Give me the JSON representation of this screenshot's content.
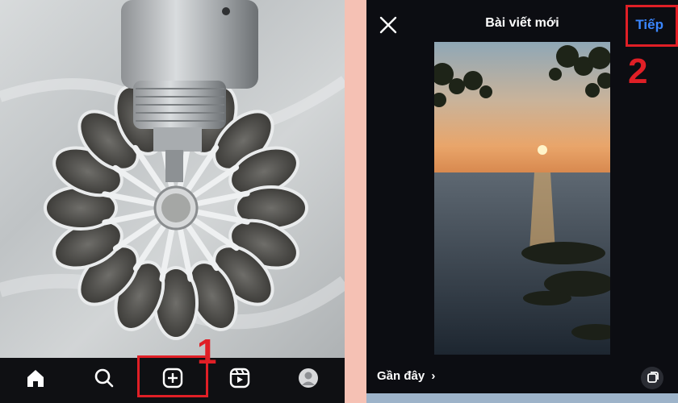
{
  "left_screen": {
    "nav": {
      "items": [
        {
          "name": "home-icon"
        },
        {
          "name": "search-icon"
        },
        {
          "name": "create-post-icon"
        },
        {
          "name": "reels-icon"
        },
        {
          "name": "profile-icon"
        }
      ]
    },
    "step_number": "1"
  },
  "right_screen": {
    "title": "Bài viết mới",
    "next_label": "Tiếp",
    "recent_label": "Gần đây",
    "step_number": "2"
  },
  "colors": {
    "accent_blue": "#3a86ff",
    "annotation_red": "#e01f26",
    "background_pink": "#f5c1b4",
    "dark_bg": "#0c0d12"
  }
}
